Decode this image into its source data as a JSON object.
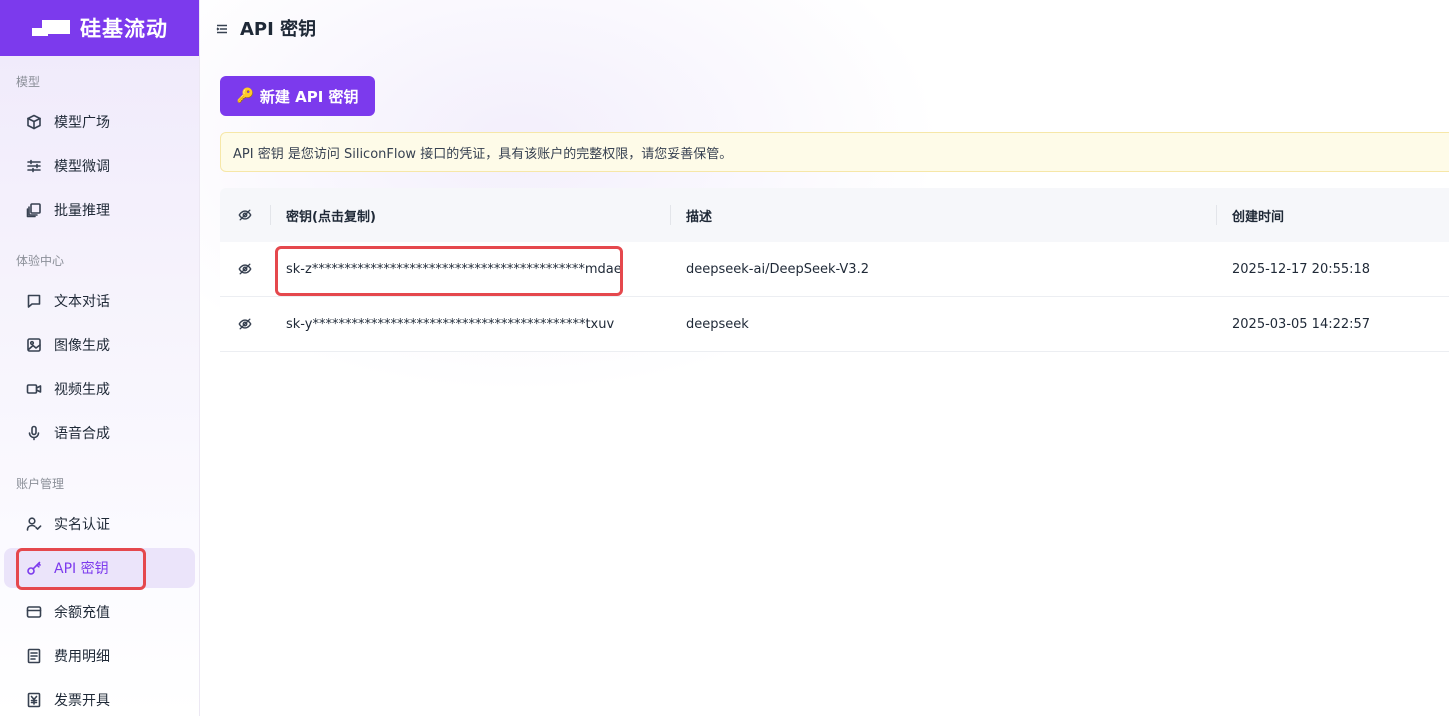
{
  "brand": {
    "name": "硅基流动"
  },
  "sidebar": {
    "sections": [
      {
        "title": "模型"
      },
      {
        "title": "体验中心"
      },
      {
        "title": "账户管理"
      }
    ],
    "items": [
      {
        "label": "模型广场",
        "icon": "cube-icon"
      },
      {
        "label": "模型微调",
        "icon": "sliders-icon"
      },
      {
        "label": "批量推理",
        "icon": "layers-icon"
      },
      {
        "label": "文本对话",
        "icon": "chat-icon"
      },
      {
        "label": "图像生成",
        "icon": "image-icon"
      },
      {
        "label": "视频生成",
        "icon": "video-icon"
      },
      {
        "label": "语音合成",
        "icon": "mic-icon"
      },
      {
        "label": "实名认证",
        "icon": "user-check-icon"
      },
      {
        "label": "API 密钥",
        "icon": "key-icon",
        "active": true
      },
      {
        "label": "余额充值",
        "icon": "card-icon"
      },
      {
        "label": "费用明细",
        "icon": "receipt-icon"
      },
      {
        "label": "发票开具",
        "icon": "invoice-icon"
      }
    ]
  },
  "header": {
    "title": "API 密钥"
  },
  "actions": {
    "new_key_label": "新建 API 密钥"
  },
  "notice": {
    "text": "API 密钥 是您访问 SiliconFlow 接口的凭证，具有该账户的完整权限，请您妥善保管。"
  },
  "table": {
    "columns": [
      "密钥(点击复制)",
      "描述",
      "创建时间"
    ],
    "rows": [
      {
        "key": "sk-z******************************************mdae",
        "description": "deepseek-ai/DeepSeek-V3.2",
        "created": "2025-12-17 20:55:18"
      },
      {
        "key": "sk-y******************************************txuv",
        "description": "deepseek",
        "created": "2025-03-05 14:22:57"
      }
    ]
  },
  "colors": {
    "accent": "#7c3aed",
    "highlight": "#e5484d",
    "notice_bg": "#fefbe8"
  }
}
